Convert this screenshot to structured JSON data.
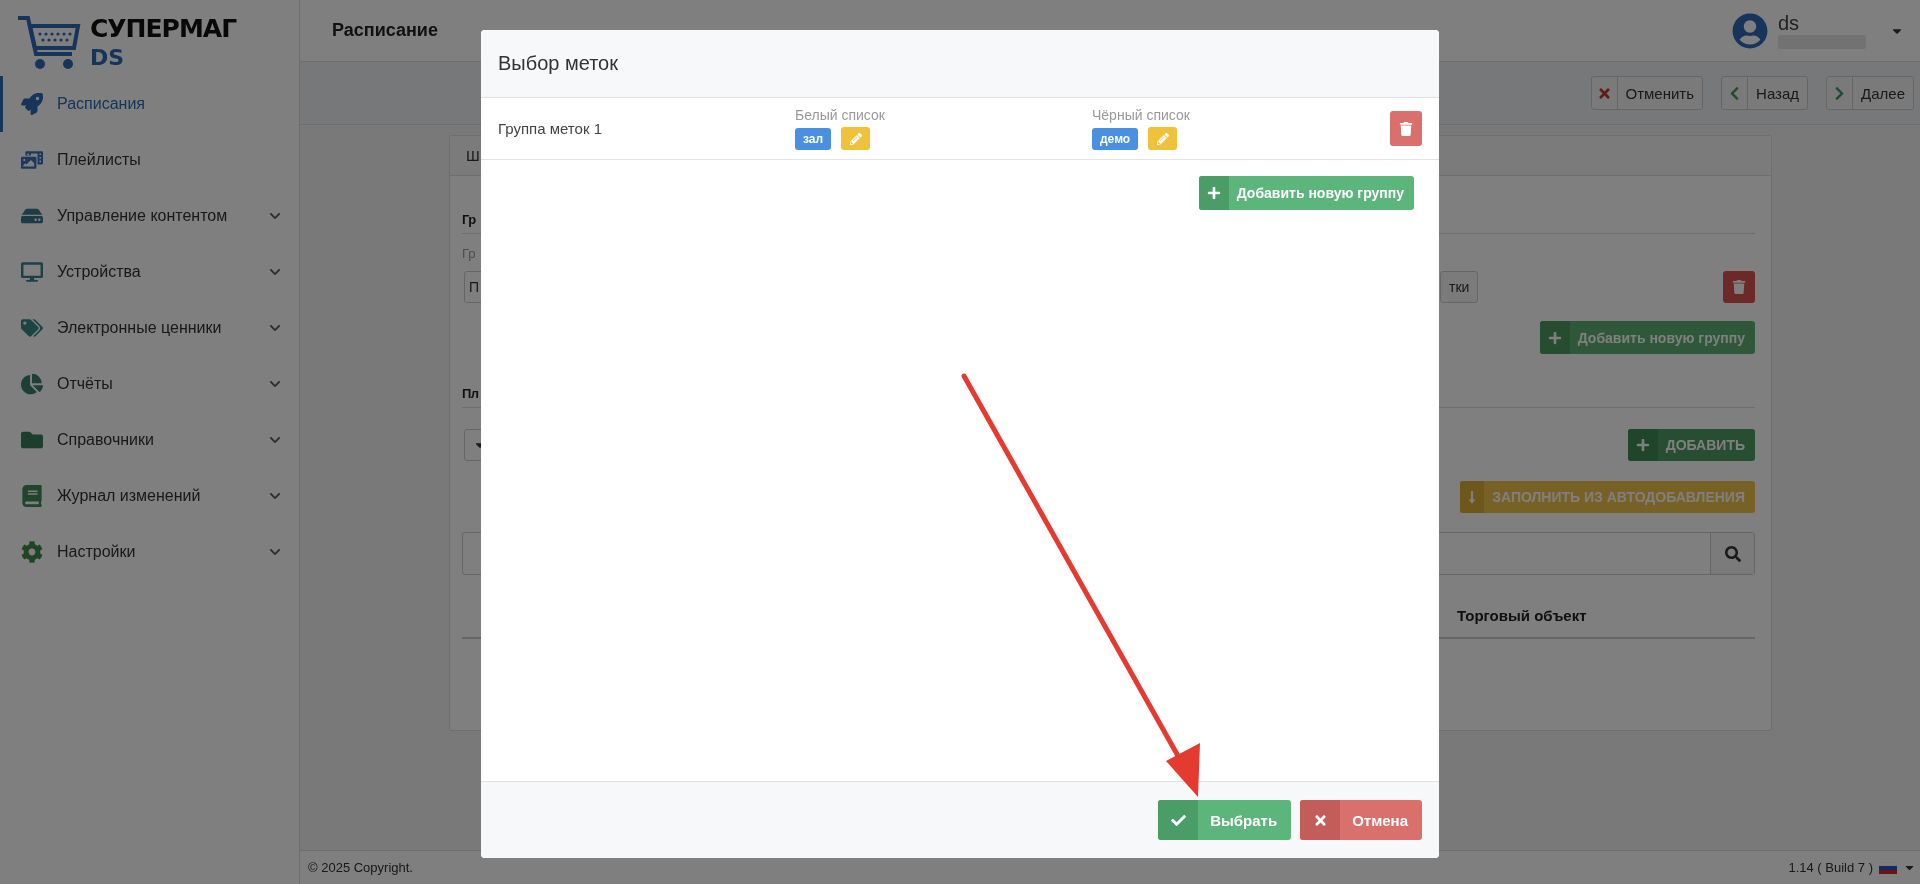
{
  "logo": {
    "title": "СУПЕРМАГ",
    "subtitle": "DS"
  },
  "sidebar": {
    "items": [
      {
        "label": "Расписания",
        "selected": true,
        "expandable": false
      },
      {
        "label": "Плейлисты",
        "selected": false,
        "expandable": false
      },
      {
        "label": "Управление контентом",
        "selected": false,
        "expandable": true
      },
      {
        "label": "Устройства",
        "selected": false,
        "expandable": true
      },
      {
        "label": "Электронные ценники",
        "selected": false,
        "expandable": true
      },
      {
        "label": "Отчёты",
        "selected": false,
        "expandable": true
      },
      {
        "label": "Справочники",
        "selected": false,
        "expandable": true
      },
      {
        "label": "Журнал изменений",
        "selected": false,
        "expandable": true
      },
      {
        "label": "Настройки",
        "selected": false,
        "expandable": true
      }
    ]
  },
  "header": {
    "title": "Расписание",
    "user": {
      "name": "ds"
    }
  },
  "toolbar": {
    "buttons": [
      {
        "label": "Отменить",
        "kind": "cancel"
      },
      {
        "label": "Назад",
        "kind": "back"
      },
      {
        "label": "Далее",
        "kind": "next"
      }
    ]
  },
  "background_card": {
    "header": "Ш",
    "section_1": {
      "heading": "Гр",
      "field_label": "Гр",
      "field_value": "П",
      "button_label": "тки",
      "add_button": "Добавить новую группу"
    },
    "section_2": {
      "heading": "Пл",
      "add_button": "ДОБАВИТЬ",
      "fill_button": "ЗАПОЛНИТЬ ИЗ АВТОДОБАВЛЕНИЯ",
      "table": {
        "columns": [
          "Торговый объект"
        ]
      }
    }
  },
  "footer": {
    "copyright": "© 2025 Copyright.",
    "version": "1.14 ( Build 7 )"
  },
  "modal": {
    "title": "Выбор меток",
    "groups": [
      {
        "name": "Группа меток 1",
        "whitelist": {
          "label": "Белый список",
          "tags": [
            "зал"
          ]
        },
        "blacklist": {
          "label": "Чёрный список",
          "tags": [
            "демо"
          ]
        }
      }
    ],
    "add_button": "Добавить новую группу",
    "buttons": [
      {
        "label": "Выбрать",
        "kind": "confirm"
      },
      {
        "label": "Отмена",
        "kind": "cancel"
      }
    ]
  }
}
